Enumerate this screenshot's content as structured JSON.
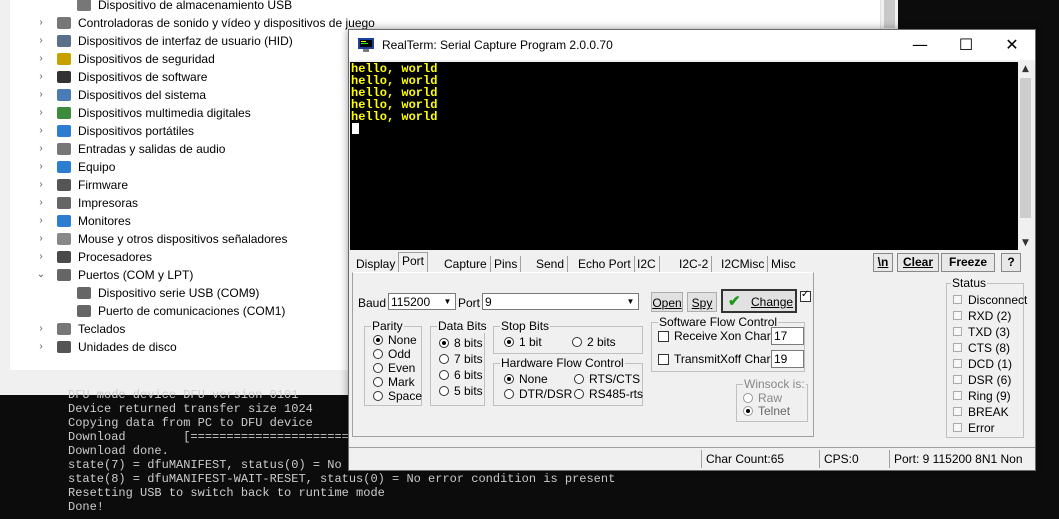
{
  "device_manager": {
    "items": [
      {
        "label": "Dispositivo de almacenamiento USB",
        "level": 2,
        "expander": "",
        "icon_color": "#777777"
      },
      {
        "label": "Controladoras de sonido y vídeo y dispositivos de juego",
        "level": 1,
        "expander": "›",
        "icon_color": "#777777"
      },
      {
        "label": "Dispositivos de interfaz de usuario (HID)",
        "level": 1,
        "expander": "›",
        "icon_color": "#5a6f8a"
      },
      {
        "label": "Dispositivos de seguridad",
        "level": 1,
        "expander": "›",
        "icon_color": "#c8a000"
      },
      {
        "label": "Dispositivos de software",
        "level": 1,
        "expander": "›",
        "icon_color": "#333333"
      },
      {
        "label": "Dispositivos del sistema",
        "level": 1,
        "expander": "›",
        "icon_color": "#4a7bb7"
      },
      {
        "label": "Dispositivos multimedia digitales",
        "level": 1,
        "expander": "›",
        "icon_color": "#3c8a3c"
      },
      {
        "label": "Dispositivos portátiles",
        "level": 1,
        "expander": "›",
        "icon_color": "#2d7dd2"
      },
      {
        "label": "Entradas y salidas de audio",
        "level": 1,
        "expander": "›",
        "icon_color": "#777777"
      },
      {
        "label": "Equipo",
        "level": 1,
        "expander": "›",
        "icon_color": "#2d7dd2"
      },
      {
        "label": "Firmware",
        "level": 1,
        "expander": "›",
        "icon_color": "#555555"
      },
      {
        "label": "Impresoras",
        "level": 1,
        "expander": "›",
        "icon_color": "#666666"
      },
      {
        "label": "Monitores",
        "level": 1,
        "expander": "›",
        "icon_color": "#2d7dd2"
      },
      {
        "label": "Mouse y otros dispositivos señaladores",
        "level": 1,
        "expander": "›",
        "icon_color": "#888888"
      },
      {
        "label": "Procesadores",
        "level": 1,
        "expander": "›",
        "icon_color": "#4a4a4a"
      },
      {
        "label": "Puertos (COM y LPT)",
        "level": 1,
        "expander": "⌄",
        "icon_color": "#666666"
      },
      {
        "label": "Dispositivo serie USB (COM9)",
        "level": 2,
        "expander": "",
        "icon_color": "#666666"
      },
      {
        "label": "Puerto de comunicaciones (COM1)",
        "level": 2,
        "expander": "",
        "icon_color": "#666666"
      },
      {
        "label": "Teclados",
        "level": 1,
        "expander": "›",
        "icon_color": "#777777"
      },
      {
        "label": "Unidades de disco",
        "level": 1,
        "expander": "›",
        "icon_color": "#555555"
      }
    ]
  },
  "console": {
    "lines": [
      "DFU mode device DFU version 0101",
      "Device returned transfer size 1024",
      "Copying data from PC to DFU device",
      "Download        [=========================",
      "Download done.",
      "state(7) = dfuMANIFEST, status(0) = No e",
      "state(8) = dfuMANIFEST-WAIT-RESET, status(0) = No error condition is present",
      "Resetting USB to switch back to runtime mode",
      "Done!"
    ]
  },
  "realterm": {
    "title": "RealTerm: Serial Capture Program 2.0.0.70",
    "window_controls": {
      "minimize": "—",
      "maximize": "☐",
      "close": "✕"
    },
    "terminal_lines": [
      "hello, world",
      "hello, world",
      "hello, world",
      "hello, world",
      "hello, world"
    ],
    "terminal_text_color": "#ffff00",
    "tabs": [
      "Display",
      "Port",
      "Capture",
      "Pins",
      "Send",
      "Echo Port",
      "I2C",
      "I2C-2",
      "I2CMisc",
      "Misc"
    ],
    "active_tab": "Port",
    "right_buttons": {
      "newline": "\\n",
      "clear": "Clear",
      "freeze": "Freeze",
      "help": "?"
    },
    "port": {
      "baud_label": "Baud",
      "baud_value": "115200",
      "port_label": "Port",
      "port_value": "9",
      "open_label": "Open",
      "spy_label": "Spy",
      "change_label": "Change",
      "parity": {
        "title": "Parity",
        "options": [
          "None",
          "Odd",
          "Even",
          "Mark",
          "Space"
        ],
        "selected": "None"
      },
      "data_bits": {
        "title": "Data Bits",
        "options": [
          "8 bits",
          "7 bits",
          "6 bits",
          "5 bits"
        ],
        "selected": "8 bits"
      },
      "stop_bits": {
        "title": "Stop Bits",
        "options": [
          "1 bit",
          "2 bits"
        ],
        "selected": "1 bit"
      },
      "hw_flow": {
        "title": "Hardware Flow Control",
        "options": [
          "None",
          "RTS/CTS",
          "DTR/DSR",
          "RS485-rts"
        ],
        "selected": "None"
      },
      "sw_flow": {
        "title": "Software Flow Control",
        "receive_label": "Receive",
        "transmit_label": "Transmit",
        "xon_label": "Xon Char:",
        "xon_value": "17",
        "xoff_label": "Xoff Char:",
        "xoff_value": "19"
      },
      "winsock": {
        "title": "Winsock is:",
        "options": [
          "Raw",
          "Telnet"
        ],
        "selected": "Telnet"
      }
    },
    "status": {
      "title": "Status",
      "items": [
        "Disconnect",
        "RXD (2)",
        "TXD (3)",
        "CTS (8)",
        "DCD (1)",
        "DSR (6)",
        "Ring (9)",
        "BREAK",
        "Error"
      ]
    },
    "statusbar": {
      "char_count": "Char Count:65",
      "cps": "CPS:0",
      "port_info": "Port: 9 115200 8N1 Non"
    }
  }
}
